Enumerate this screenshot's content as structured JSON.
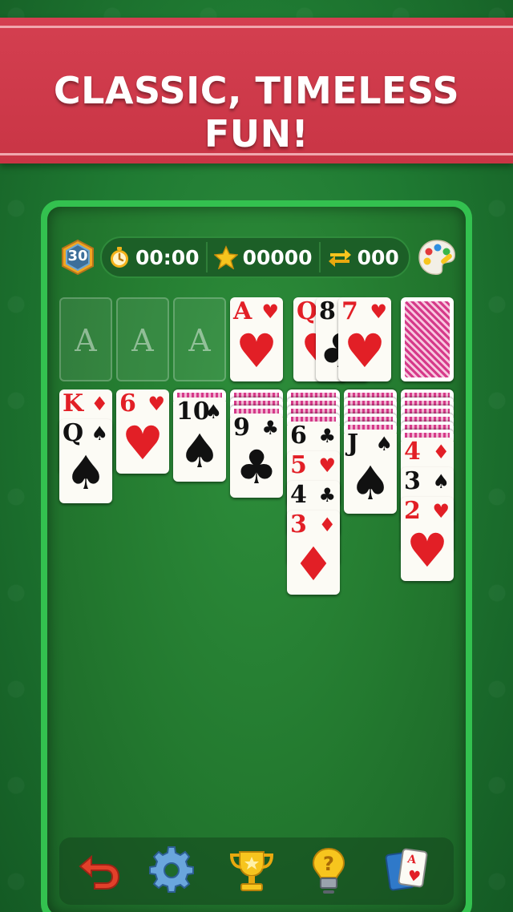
{
  "banner": {
    "title": "CLASSIC, TIMELESS FUN!"
  },
  "hud": {
    "level": "30",
    "timer": "00:00",
    "score": "00000",
    "moves": "000",
    "icons": [
      "level-hex-icon",
      "stopwatch-icon",
      "star-icon",
      "swap-arrows-icon",
      "palette-icon"
    ]
  },
  "foundations": [
    {
      "label": "A"
    },
    {
      "label": "A"
    },
    {
      "label": "A"
    },
    {
      "rank": "A",
      "suit": "♥",
      "color": "red"
    }
  ],
  "waste": [
    {
      "rank": "Q",
      "suit": "♥",
      "color": "red"
    },
    {
      "rank": "8",
      "suit": "♣",
      "color": "black"
    },
    {
      "rank": "7",
      "suit": "♥",
      "color": "red"
    }
  ],
  "tableau": [
    {
      "hidden": 0,
      "cards": [
        {
          "rank": "K",
          "suit": "♦",
          "color": "red"
        },
        {
          "rank": "Q",
          "suit": "♠",
          "color": "black"
        }
      ]
    },
    {
      "hidden": 0,
      "cards": [
        {
          "rank": "6",
          "suit": "♥",
          "color": "red"
        }
      ]
    },
    {
      "hidden": 1,
      "cards": [
        {
          "rank": "10",
          "suit": "♠",
          "color": "black"
        }
      ]
    },
    {
      "hidden": 3,
      "cards": [
        {
          "rank": "9",
          "suit": "♣",
          "color": "black"
        }
      ]
    },
    {
      "hidden": 4,
      "cards": [
        {
          "rank": "6",
          "suit": "♣",
          "color": "black"
        },
        {
          "rank": "5",
          "suit": "♥",
          "color": "red"
        },
        {
          "rank": "4",
          "suit": "♣",
          "color": "black"
        },
        {
          "rank": "3",
          "suit": "♦",
          "color": "red"
        }
      ]
    },
    {
      "hidden": 5,
      "cards": [
        {
          "rank": "J",
          "suit": "♠",
          "color": "black"
        }
      ]
    },
    {
      "hidden": 6,
      "cards": [
        {
          "rank": "4",
          "suit": "♦",
          "color": "red"
        },
        {
          "rank": "3",
          "suit": "♠",
          "color": "black"
        },
        {
          "rank": "2",
          "suit": "♥",
          "color": "red"
        }
      ]
    }
  ],
  "toolbar": {
    "items": [
      {
        "name": "undo-button",
        "icon": "undo-arrow-icon"
      },
      {
        "name": "settings-button",
        "icon": "gear-icon"
      },
      {
        "name": "leaderboard-button",
        "icon": "trophy-icon"
      },
      {
        "name": "hint-button",
        "icon": "lightbulb-icon"
      },
      {
        "name": "new-game-button",
        "icon": "cards-icon"
      }
    ]
  },
  "colors": {
    "banner_red": "#d43f50",
    "felt_green": "#23792f",
    "board_border": "#33c14f",
    "card_red": "#e21f26",
    "card_back_pink": "#d63a8a"
  }
}
